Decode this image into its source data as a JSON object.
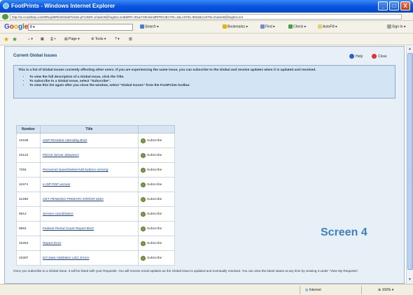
{
  "window": {
    "title": "FootPrints - Windows Internet Explorer",
    "buttons": {
      "minimize": "_",
      "maximize": "□",
      "close": "X"
    }
  },
  "address": {
    "url": "http://ss.ecuathelp.com/MRcgi/MRlistGlobalTickets.pl?USER=nhackett@hughes.net&MRP=00uLFS8VwlmdRPROJECTID=1&LASTID=9922&CUSTM=nhackett@hughes.net"
  },
  "google_toolbar": {
    "logo": [
      "G",
      "o",
      "o",
      "g",
      "l",
      "e"
    ],
    "search_value": "8 ▾",
    "search_label": "Search ▾",
    "bookmarks": "Bookmarks ▾",
    "find": "Find ▾",
    "check": "Check ▾",
    "autofill": "AutoFill ▾",
    "signin": "Sign In ▾"
  },
  "command_bar": {
    "page": "Page ▾",
    "tools": "Tools ▾"
  },
  "page": {
    "title": "Current Global Issues",
    "help": "Help",
    "close": "Close",
    "description": "This is a list of Global Issues currently affecting other users. If you are experiencing the same issue, you can subscribe to the Global and receive updates when it is updated and resolved.",
    "bullets": [
      "To view the full description of a Global Issue, click the Title.",
      "To subscribe to a Global Issue, select \"Subscribe\".",
      "To view this list again after you close the window, select \"Global Issues\" from the FootPrints toolbar."
    ],
    "table": {
      "headers": [
        "Number",
        "Title",
        ""
      ],
      "subscribe_label": "Subscribe",
      "rows": [
        {
          "number": "10196",
          "title": "eISP Resident Attending BUG"
        },
        {
          "number": "10122",
          "title": "PECIS Server Slowness"
        },
        {
          "number": "7294",
          "title": "Personnel Save/Delete/Add buttons missing"
        },
        {
          "number": "11574",
          "title": "e-ISP PDF version"
        },
        {
          "number": "11498",
          "title": "GET PENDING PRIMARY ERROR MSG"
        },
        {
          "number": "9612",
          "title": "Service coordinators"
        },
        {
          "number": "9564",
          "title": "Federal Period Count Report BUG"
        },
        {
          "number": "10264",
          "title": "Report Error"
        },
        {
          "number": "10287",
          "title": "EO Data Validation USC Errors"
        }
      ]
    },
    "footnote": "Once you subscribe to a Global Issue, it will be listed with your Requests. You will receive email updates as the Global Issue is updated and eventually resolved. You can view the latest status at any time by viewing it under \"View My Requests\".",
    "screen_label": "Screen 4"
  },
  "status": {
    "zone": "Internet",
    "zoom": "100%"
  }
}
